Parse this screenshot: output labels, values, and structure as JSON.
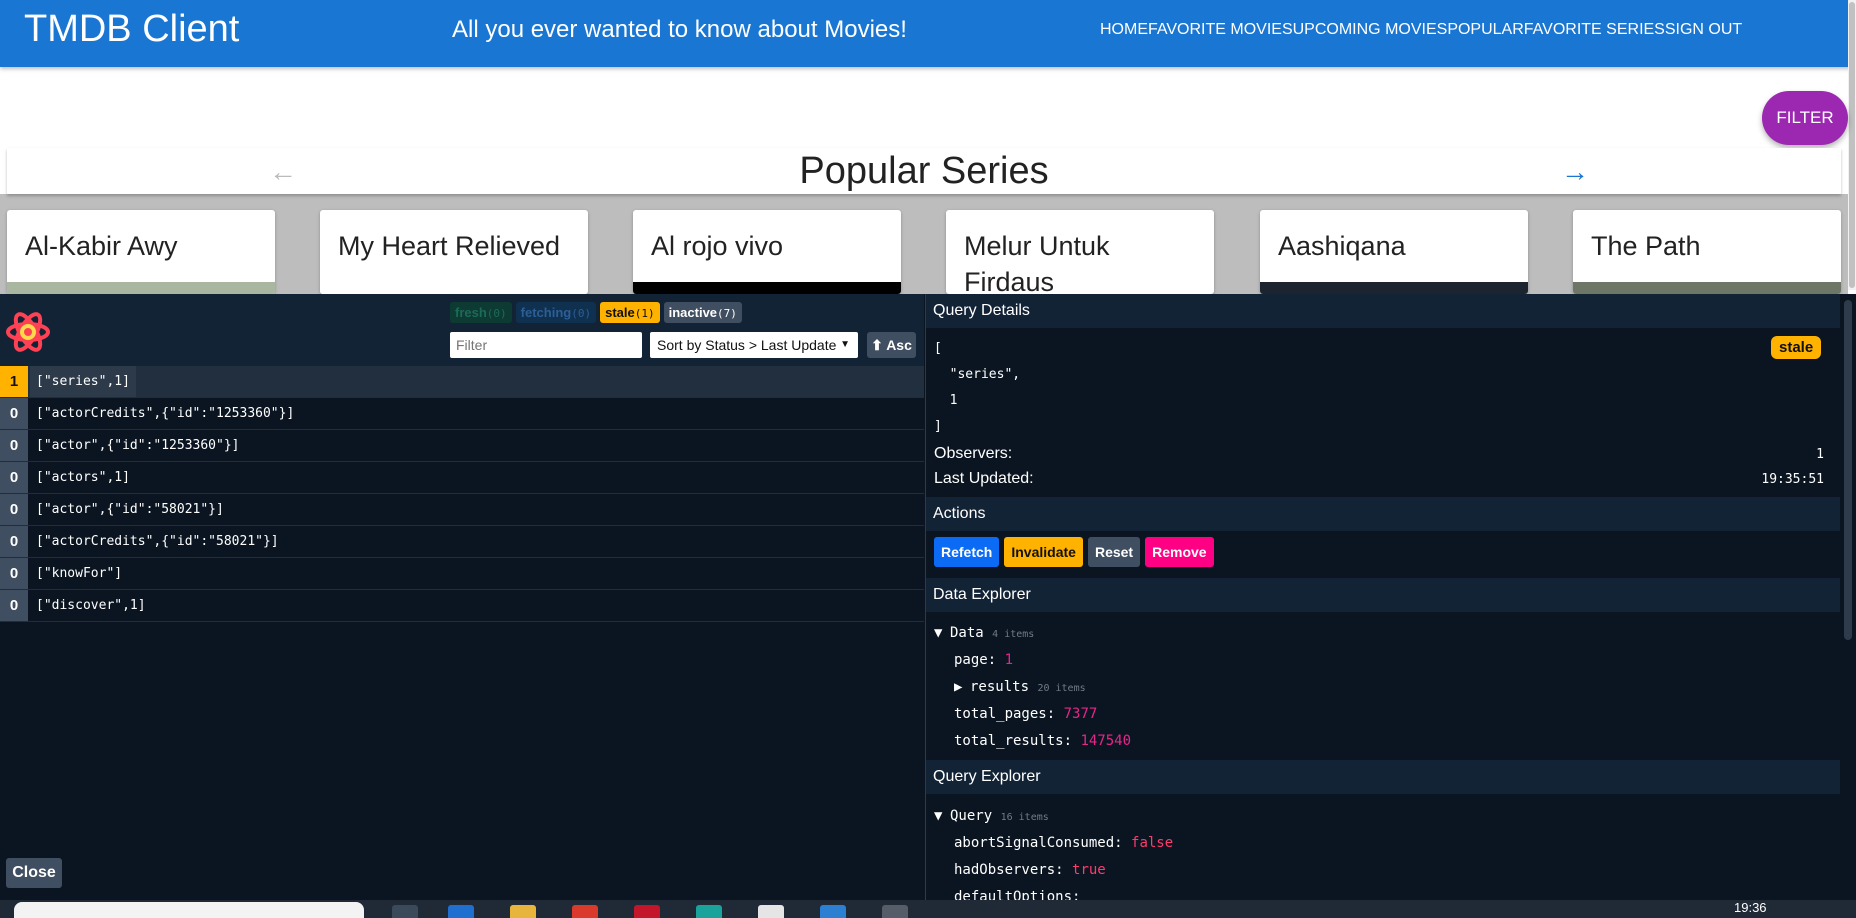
{
  "app": {
    "title": "TMDB Client",
    "tagline": "All you ever wanted to know about Movies!",
    "nav": [
      "HOME",
      "FAVORITE MOVIES",
      "UPCOMING MOVIES",
      "POPULAR",
      "FAVORITE SERIES",
      "SIGN OUT"
    ],
    "filter_label": "FILTER",
    "section_title": "Popular Series",
    "cards": [
      "Al-Kabir Awy",
      "My Heart Relieved",
      "Al rojo vivo",
      "Melur Untuk Firdaus",
      "Aashiqana",
      "The Path"
    ]
  },
  "devtools": {
    "counts": {
      "fresh": {
        "label": "fresh",
        "n": "(0)"
      },
      "fetching": {
        "label": "fetching",
        "n": "(0)"
      },
      "stale": {
        "label": "stale",
        "n": "(1)"
      },
      "inactive": {
        "label": "inactive",
        "n": "(7)"
      }
    },
    "filter_placeholder": "Filter",
    "sort_label": "Sort by Status > Last Update",
    "asc_label": "⬆ Asc",
    "queries": [
      {
        "observers": "1",
        "key": "[\"series\",1]"
      },
      {
        "observers": "0",
        "key": "[\"actorCredits\",{\"id\":\"1253360\"}]"
      },
      {
        "observers": "0",
        "key": "[\"actor\",{\"id\":\"1253360\"}]"
      },
      {
        "observers": "0",
        "key": "[\"actors\",1]"
      },
      {
        "observers": "0",
        "key": "[\"actor\",{\"id\":\"58021\"}]"
      },
      {
        "observers": "0",
        "key": "[\"actorCredits\",{\"id\":\"58021\"}]"
      },
      {
        "observers": "0",
        "key": "[\"knowFor\"]"
      },
      {
        "observers": "0",
        "key": "[\"discover\",1]"
      }
    ],
    "close_label": "Close",
    "details": {
      "heading": "Query Details",
      "json": "[\n  \"series\",\n  1\n]",
      "status": "stale",
      "observers_label": "Observers:",
      "observers_value": "1",
      "updated_label": "Last Updated:",
      "updated_value": "19:35:51"
    },
    "actions": {
      "heading": "Actions",
      "refetch": "Refetch",
      "invalidate": "Invalidate",
      "reset": "Reset",
      "remove": "Remove"
    },
    "data_explorer": {
      "heading": "Data Explorer",
      "root_label": "Data",
      "root_count": "4 items",
      "page_key": "page:",
      "page_val": "1",
      "results_key": "results",
      "results_count": "20 items",
      "total_pages_key": "total_pages:",
      "total_pages_val": "7377",
      "total_results_key": "total_results:",
      "total_results_val": "147540"
    },
    "query_explorer": {
      "heading": "Query Explorer",
      "root_label": "Query",
      "root_count": "16 items",
      "abort_key": "abortSignalConsumed:",
      "abort_val": "false",
      "had_key": "hadObservers:",
      "had_val": "true",
      "default_key": "defaultOptions:"
    }
  },
  "taskbar": {
    "time": "19:36"
  },
  "colors": {
    "appbar": "#1976d2",
    "fab": "#9c27b0",
    "devtools_bg": "#0b1521",
    "stale": "#ffb200"
  }
}
